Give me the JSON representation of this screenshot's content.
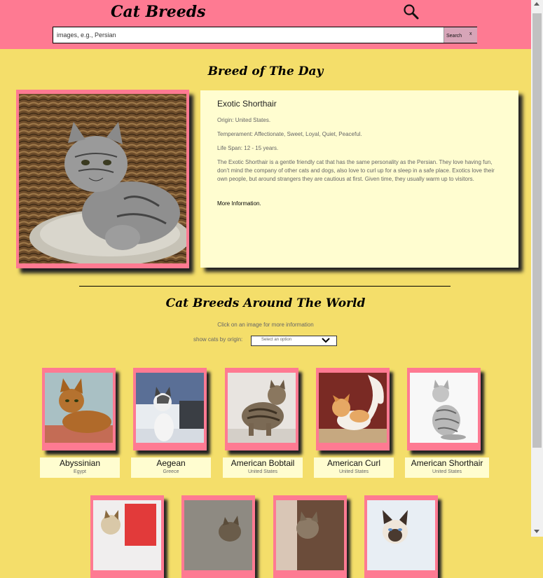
{
  "header": {
    "title": "Cat Breeds",
    "search_placeholder": "images, e.g., Persian",
    "search_button": "Search",
    "clear_button": "x"
  },
  "breed_of_day": {
    "heading": "Breed of The Day",
    "name": "Exotic Shorthair",
    "origin": "Origin: United States.",
    "temperament": "Temperament: Affectionate, Sweet, Loyal, Quiet, Peaceful.",
    "life_span": "Life Span: 12 - 15 years.",
    "description": "The Exotic Shorthair is a gentle friendly cat that has the same personality as the Persian. They love having fun, don’t mind the company of other cats and dogs, also love to curl up for a sleep in a safe place. Exotics love their own people, but around strangers they are cautious at first. Given time, they usually warm up to visitors.",
    "more_link": "More Information."
  },
  "gallery": {
    "heading": "Cat Breeds Around The World",
    "help": "Click on an image for more information",
    "filter_label": "show cats by origin:",
    "filter_value": "Select an option",
    "breeds": [
      {
        "name": "Abyssinian",
        "origin": "Egypt"
      },
      {
        "name": "Aegean",
        "origin": "Greece"
      },
      {
        "name": "American Bobtail",
        "origin": "United States"
      },
      {
        "name": "American Curl",
        "origin": "United States"
      },
      {
        "name": "American Shorthair",
        "origin": "United States"
      }
    ]
  },
  "colors": {
    "header_bg": "#fe7a92",
    "page_bg": "#f4de6a",
    "card_bg": "#fffdd0",
    "frame": "#fe7a92"
  }
}
